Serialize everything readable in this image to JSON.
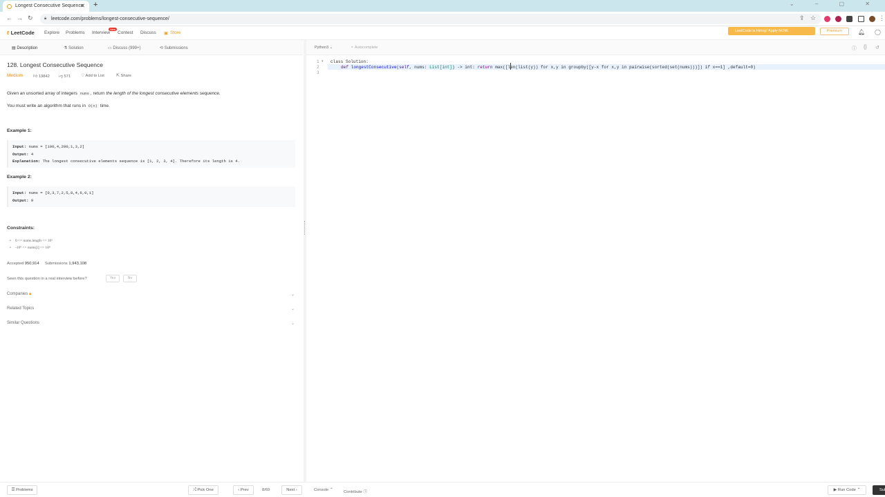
{
  "browser": {
    "tab_title": "Longest Consecutive Sequence",
    "url": "leetcode.com/problems/longest-consecutive-sequence/"
  },
  "nav": {
    "logo": "LeetCode",
    "explore": "Explore",
    "problems": "Problems",
    "interview": "Interview",
    "new_badge": "New",
    "contest": "Contest",
    "discuss": "Discuss",
    "store": "Store",
    "hiring": "LeetCode is Hiring! Apply NOW.",
    "premium": "Premium"
  },
  "left_tabs": {
    "description": "Description",
    "solution": "Solution",
    "discuss": "Discuss (999+)",
    "submissions": "Submissions"
  },
  "problem": {
    "title": "128. Longest Consecutive Sequence",
    "difficulty": "Medium",
    "likes": "13842",
    "dislikes": "571",
    "add_to_list": "Add to List",
    "share": "Share",
    "desc_pre": "Given an unsorted array of integers",
    "desc_var": "nums",
    "desc_post": ", return",
    "desc_italic": "the length of the longest consecutive elements sequence.",
    "algo_pre": "You must write an algorithm that runs in",
    "algo_code": "O(n)",
    "algo_post": "time."
  },
  "examples": [
    {
      "heading": "Example 1:",
      "input_label": "Input:",
      "input": "nums = [100,4,200,1,3,2]",
      "output_label": "Output:",
      "output": "4",
      "explanation_label": "Explanation:",
      "explanation": "The longest consecutive elements sequence is [1, 2, 3, 4]. Therefore its length is 4."
    },
    {
      "heading": "Example 2:",
      "input_label": "Input:",
      "input": "nums = [0,3,7,2,5,8,4,6,0,1]",
      "output_label": "Output:",
      "output": "9"
    }
  ],
  "constraints": {
    "heading": "Constraints:",
    "items": [
      "0 <= nums.length <= 10⁵",
      "-10⁹ <= nums[i] <= 10⁹"
    ]
  },
  "stats": {
    "accepted_label": "Accepted",
    "accepted": "950,914",
    "submissions_label": "Submissions",
    "submissions": "1,943,108"
  },
  "interview": {
    "question": "Seen this question in a real interview before?",
    "yes": "Yes",
    "no": "No"
  },
  "sections": [
    "Companies",
    "Related Topics",
    "Similar Questions"
  ],
  "editor": {
    "language": "Python3",
    "autocomplete": "Autocomplete",
    "line_numbers": [
      "1",
      "2",
      "3"
    ],
    "line1": "class Solution:",
    "line2_def": "def",
    "line2_name": "longestConsecutive",
    "line2_self": "self",
    "line2_rest": ", nums: ",
    "line2_type": "List[int]",
    "line2_ret": ") -> int: ",
    "line2_return": "return",
    "line2_body": "max([len(list(y)) for x,y in groupby([y-x for x,y in pairwise(sorted(set(nums)))]) if x==1] ,default=0)"
  },
  "bottom": {
    "problems": "Problems",
    "pick_one": "Pick One",
    "prev": "Prev",
    "page": "8/69",
    "next": "Next",
    "console": "Console",
    "contribute": "Contribute",
    "run_code": "Run Code",
    "submit": "Submit"
  }
}
